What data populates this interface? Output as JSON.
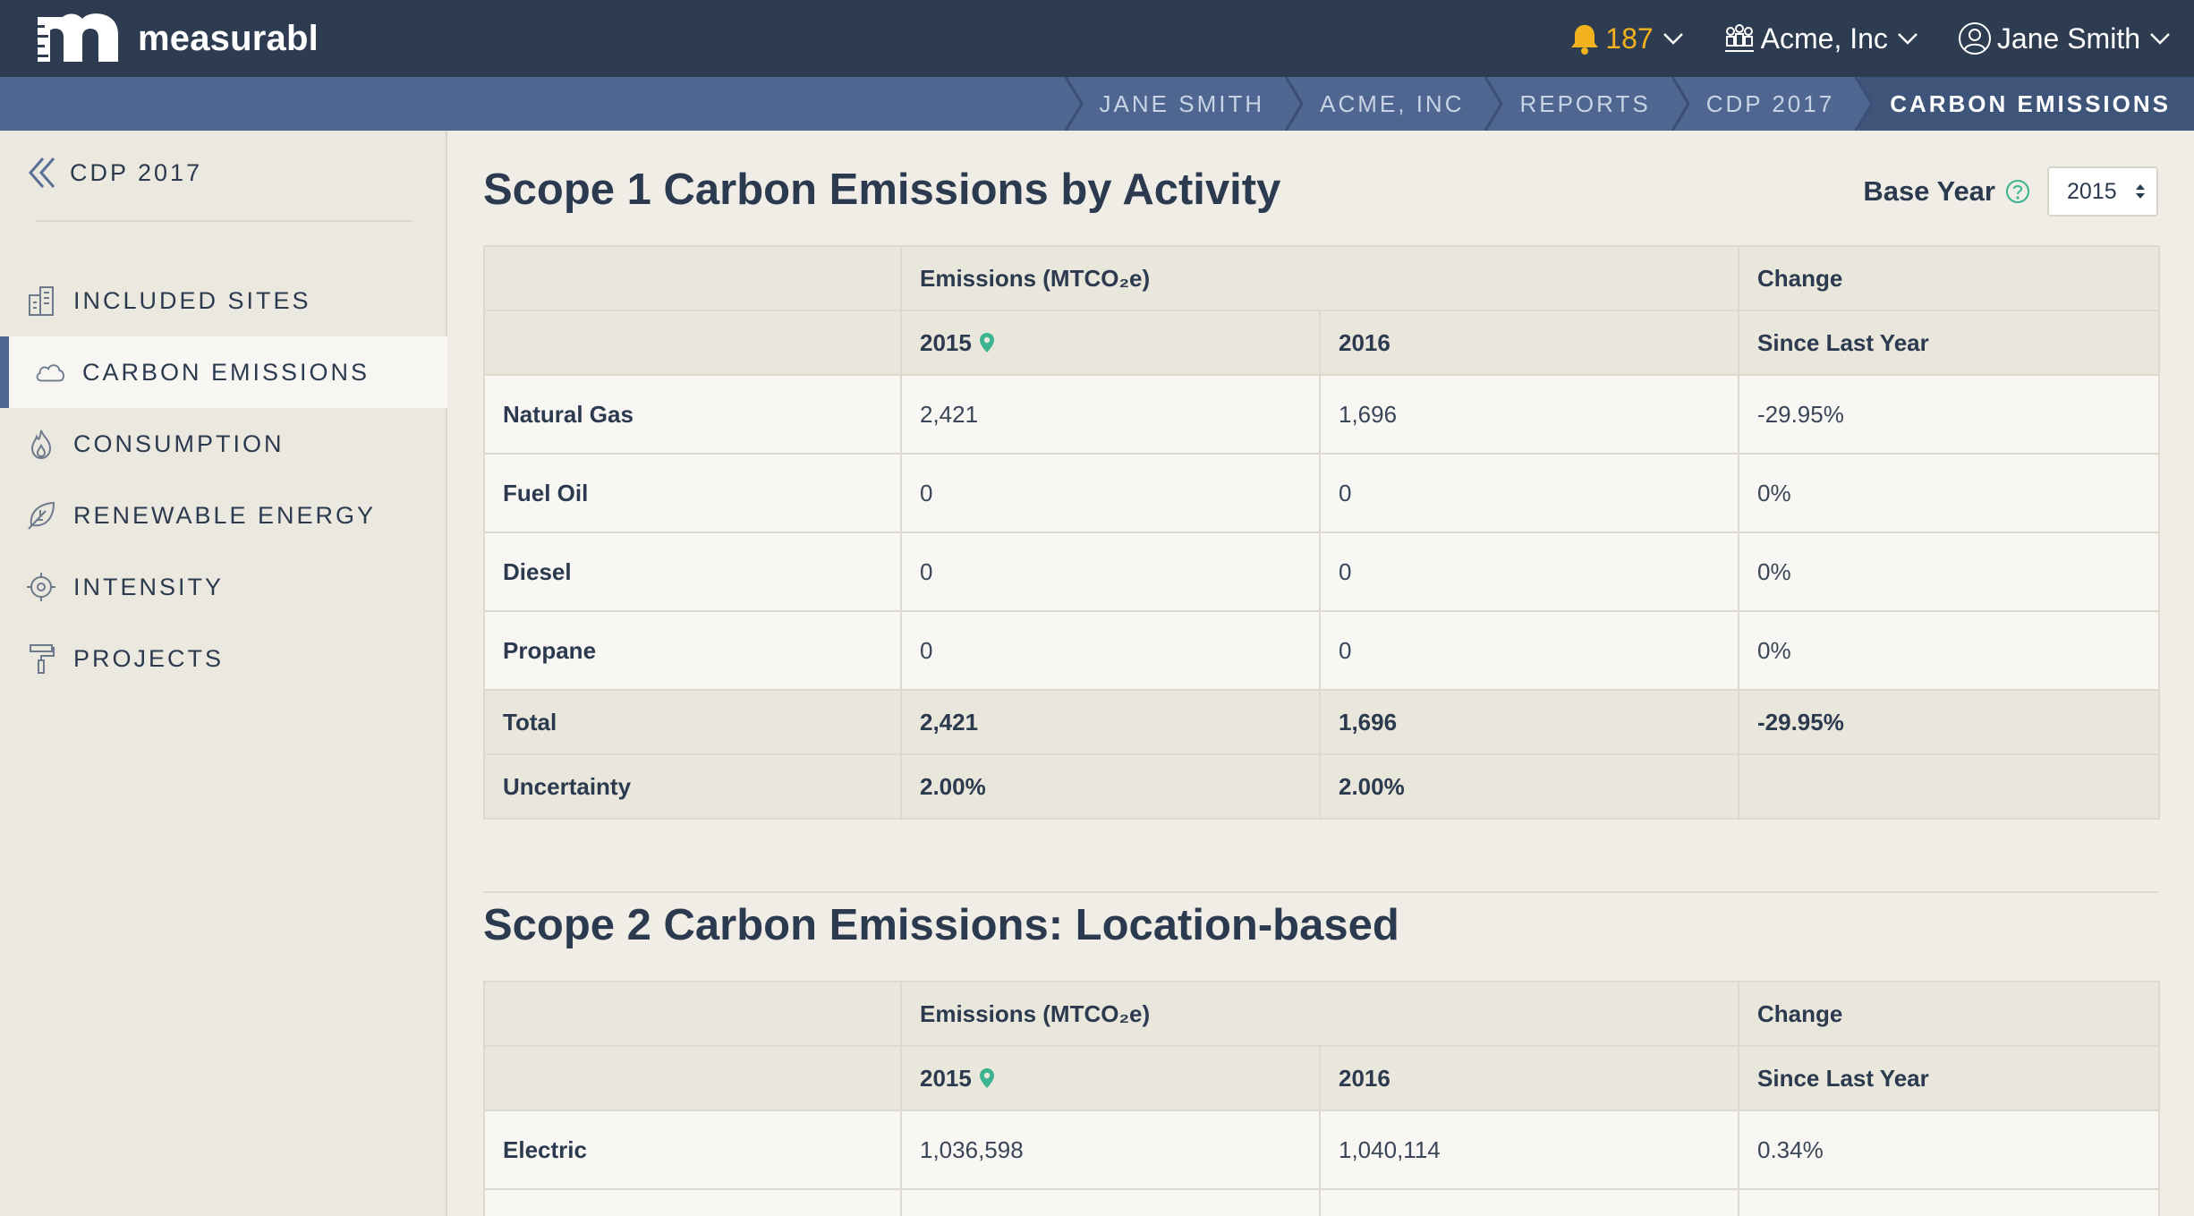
{
  "brand": {
    "name": "measurabl"
  },
  "topbar": {
    "notifications_count": "187",
    "organization": "Acme, Inc",
    "user": "Jane Smith"
  },
  "breadcrumbs": [
    "JANE SMITH",
    "ACME, INC",
    "REPORTS",
    "CDP 2017",
    "CARBON EMISSIONS"
  ],
  "sidebar": {
    "back_label": "CDP 2017",
    "items": [
      {
        "label": "INCLUDED SITES",
        "icon": "building-icon"
      },
      {
        "label": "CARBON EMISSIONS",
        "icon": "cloud-icon"
      },
      {
        "label": "CONSUMPTION",
        "icon": "flame-icon"
      },
      {
        "label": "RENEWABLE ENERGY",
        "icon": "leaf-icon"
      },
      {
        "label": "INTENSITY",
        "icon": "target-icon"
      },
      {
        "label": "PROJECTS",
        "icon": "paint-roller-icon"
      }
    ],
    "active_index": 1
  },
  "base_year": {
    "label": "Base Year",
    "selected": "2015"
  },
  "scope1": {
    "title": "Scope 1 Carbon Emissions by Activity",
    "header_emissions": "Emissions (MTCO₂e)",
    "header_change": "Change",
    "year_a": "2015",
    "year_b": "2016",
    "since_last_year": "Since Last Year",
    "rows": [
      {
        "label": "Natural Gas",
        "a": "2,421",
        "b": "1,696",
        "change": "-29.95%"
      },
      {
        "label": "Fuel Oil",
        "a": "0",
        "b": "0",
        "change": "0%"
      },
      {
        "label": "Diesel",
        "a": "0",
        "b": "0",
        "change": "0%"
      },
      {
        "label": "Propane",
        "a": "0",
        "b": "0",
        "change": "0%"
      }
    ],
    "total": {
      "label": "Total",
      "a": "2,421",
      "b": "1,696",
      "change": "-29.95%"
    },
    "uncertainty": {
      "label": "Uncertainty",
      "a": "2.00%",
      "b": "2.00%"
    }
  },
  "scope2": {
    "title": "Scope 2 Carbon Emissions: Location-based",
    "header_emissions": "Emissions (MTCO₂e)",
    "header_change": "Change",
    "year_a": "2015",
    "year_b": "2016",
    "since_last_year": "Since Last Year",
    "rows": [
      {
        "label": "Electric",
        "a": "1,036,598",
        "b": "1,040,114",
        "change": "0.34%"
      }
    ]
  },
  "colors": {
    "topbar": "#2e3c52",
    "breadcrumb_bar": "#4e6690",
    "accent_teal": "#3bb48f",
    "alert_yellow": "#f2b21d",
    "increase_orange": "#f2a922"
  }
}
